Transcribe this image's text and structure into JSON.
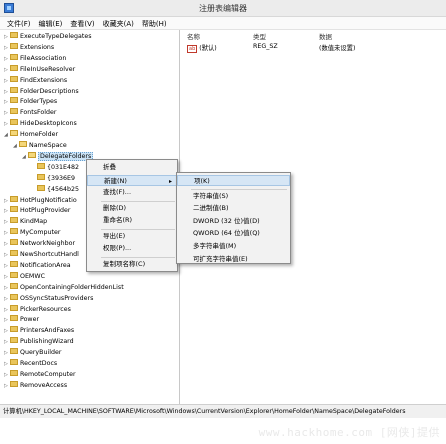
{
  "window": {
    "title": "注册表编辑器"
  },
  "menubar": [
    "文件(F)",
    "编辑(E)",
    "查看(V)",
    "收藏夹(A)",
    "帮助(H)"
  ],
  "tree": [
    {
      "label": "ExecuteTypeDelegates",
      "depth": 0,
      "expanded": false
    },
    {
      "label": "Extensions",
      "depth": 0,
      "expanded": false
    },
    {
      "label": "FileAssociation",
      "depth": 0,
      "expanded": false
    },
    {
      "label": "FileInUseResolver",
      "depth": 0,
      "expanded": false
    },
    {
      "label": "FindExtensions",
      "depth": 0,
      "expanded": false
    },
    {
      "label": "FolderDescriptions",
      "depth": 0,
      "expanded": false
    },
    {
      "label": "FolderTypes",
      "depth": 0,
      "expanded": false
    },
    {
      "label": "FontsFolder",
      "depth": 0,
      "expanded": false
    },
    {
      "label": "HideDesktopIcons",
      "depth": 0,
      "expanded": false
    },
    {
      "label": "HomeFolder",
      "depth": 0,
      "expanded": true
    },
    {
      "label": "NameSpace",
      "depth": 1,
      "expanded": true
    },
    {
      "label": "DelegateFolders",
      "depth": 2,
      "expanded": true,
      "selected": true
    },
    {
      "label": "{031E482",
      "depth": 3,
      "expanded": false
    },
    {
      "label": "{3936E9",
      "depth": 3,
      "expanded": false
    },
    {
      "label": "{4564b25",
      "depth": 3,
      "expanded": false
    },
    {
      "label": "HotPlugNotificatio",
      "depth": 0,
      "expanded": false
    },
    {
      "label": "HotPlugProvider",
      "depth": 0,
      "expanded": false
    },
    {
      "label": "KindMap",
      "depth": 0,
      "expanded": false
    },
    {
      "label": "MyComputer",
      "depth": 0,
      "expanded": false
    },
    {
      "label": "NetworkNeighbor",
      "depth": 0,
      "expanded": false
    },
    {
      "label": "NewShortcutHandl",
      "depth": 0,
      "expanded": false
    },
    {
      "label": "NotificationArea",
      "depth": 0,
      "expanded": false
    },
    {
      "label": "OEMWC",
      "depth": 0,
      "expanded": false
    },
    {
      "label": "OpenContainingFolderHiddenList",
      "depth": 0,
      "expanded": false
    },
    {
      "label": "OSSyncStatusProviders",
      "depth": 0,
      "expanded": false
    },
    {
      "label": "PickerResources",
      "depth": 0,
      "expanded": false
    },
    {
      "label": "Power",
      "depth": 0,
      "expanded": false
    },
    {
      "label": "PrintersAndFaxes",
      "depth": 0,
      "expanded": false
    },
    {
      "label": "PublishingWizard",
      "depth": 0,
      "expanded": false
    },
    {
      "label": "QueryBuilder",
      "depth": 0,
      "expanded": false
    },
    {
      "label": "RecentDocs",
      "depth": 0,
      "expanded": false
    },
    {
      "label": "RemoteComputer",
      "depth": 0,
      "expanded": false
    },
    {
      "label": "RemoveAccess",
      "depth": 0,
      "expanded": false
    }
  ],
  "list": {
    "columns": [
      "名称",
      "类型",
      "数据"
    ],
    "rows": [
      {
        "name": "(默认)",
        "type": "REG_SZ",
        "data": "(数值未设置)",
        "icon": "ab-string-icon"
      }
    ]
  },
  "context_menu": {
    "items": [
      {
        "label": "折叠",
        "has_submenu": false
      },
      {
        "label": "新建(N)",
        "has_submenu": true,
        "highlight": true
      },
      {
        "label": "查找(F)...",
        "has_submenu": false
      },
      {
        "separator": true
      },
      {
        "label": "删除(D)",
        "has_submenu": false
      },
      {
        "label": "重命名(R)",
        "has_submenu": false
      },
      {
        "separator": true
      },
      {
        "label": "导出(E)",
        "has_submenu": false
      },
      {
        "label": "权限(P)...",
        "has_submenu": false
      },
      {
        "separator": true
      },
      {
        "label": "复制项名称(C)",
        "has_submenu": false
      }
    ]
  },
  "submenu": {
    "items": [
      {
        "label": "项(K)",
        "highlight": true
      },
      {
        "separator": true
      },
      {
        "label": "字符串值(S)"
      },
      {
        "label": "二进制值(B)"
      },
      {
        "label": "DWORD (32 位)值(D)"
      },
      {
        "label": "QWORD (64 位)值(Q)"
      },
      {
        "label": "多字符串值(M)"
      },
      {
        "label": "可扩充字符串值(E)"
      }
    ]
  },
  "status": "计算机\\HKEY_LOCAL_MACHINE\\SOFTWARE\\Microsoft\\Windows\\CurrentVersion\\Explorer\\HomeFolder\\NameSpace\\DelegateFolders",
  "watermark": "www.hackhome.com [网侠]提供",
  "colors": {
    "selection": "#cce4f7",
    "menu_bg": "#f2f2f2",
    "highlight": "#d6e6f5",
    "folder": "#e9c55b"
  }
}
